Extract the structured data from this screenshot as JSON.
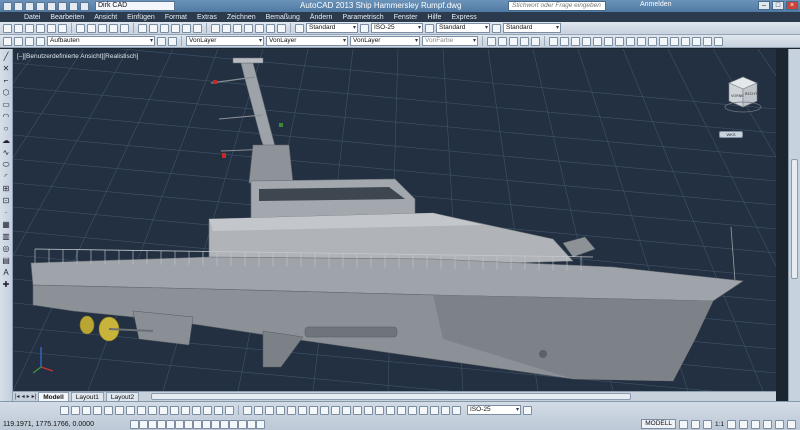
{
  "titlebar": {
    "workspace": "Dirk CAD",
    "title": "AutoCAD 2013  Ship Hammersley Rumpf.dwg",
    "search_placeholder": "Stichwort oder Frage eingeben",
    "login": "Anmelden",
    "minimize": "–",
    "maximize": "□",
    "close": "×"
  },
  "menu": [
    "Datei",
    "Bearbeiten",
    "Ansicht",
    "Einfügen",
    "Format",
    "Extras",
    "Zeichnen",
    "Bemaßung",
    "Ändern",
    "Parametrisch",
    "Fenster",
    "Hilfe",
    "Express"
  ],
  "toolbar1": {
    "text_style": "Standard",
    "dim_style": "ISO-25",
    "table_style": "Standard",
    "mleader_style": "Standard"
  },
  "toolbar2": {
    "layer": "Aufbauten",
    "color": "VonLayer",
    "linetype": "VonLayer",
    "lineweight": "VonLayer",
    "plotstyle": "VonFarbe"
  },
  "viewport": {
    "label": "[–][Benutzerdefinierte Ansicht][Realistisch]",
    "viewcube_left": "VORNE",
    "viewcube_right": "RECHTS",
    "wcs_label": "WKS"
  },
  "tabs": [
    "Modell",
    "Layout1",
    "Layout2"
  ],
  "status": {
    "coordinates": "119.1971, 1775.1766, 0.0000",
    "annotation_scale_style": "ISO-25",
    "model_button": "MODELL",
    "scale": "1:1"
  },
  "colors": {
    "viewport_bg": "#233041",
    "grid": "#3f5468",
    "hull": "#a9adb2",
    "propeller": "#c8b43a"
  }
}
